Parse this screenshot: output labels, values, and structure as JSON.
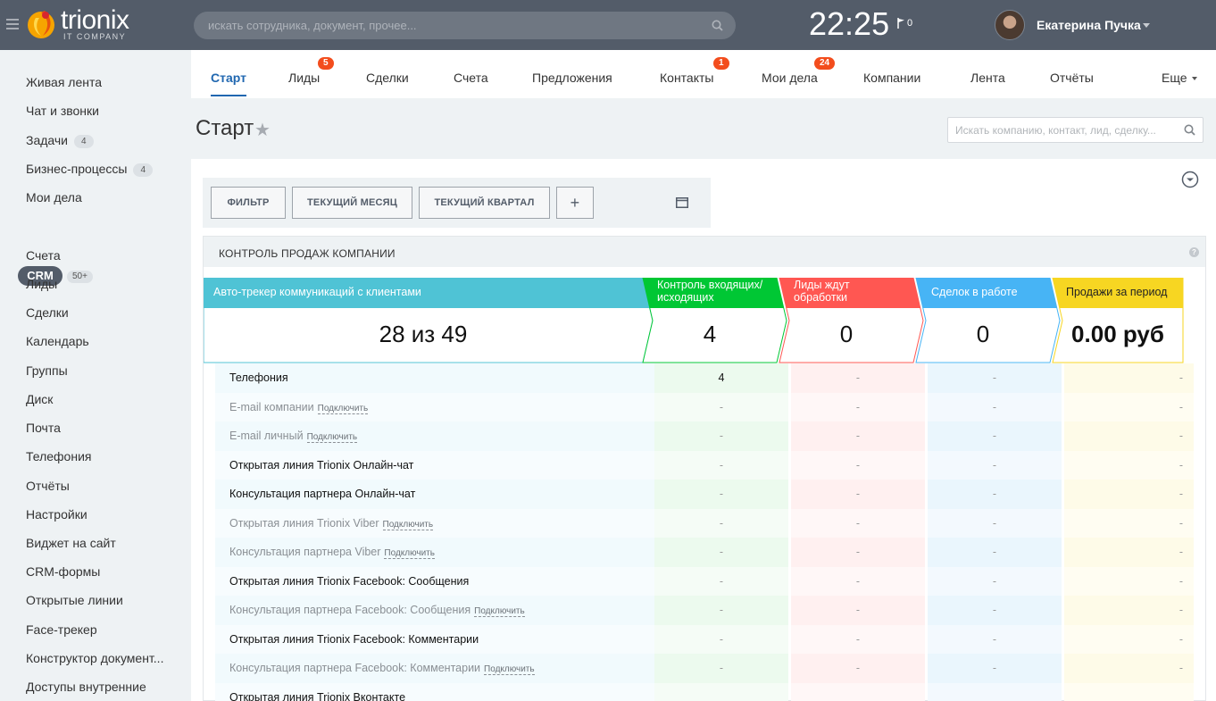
{
  "header": {
    "logo_text": "trionix",
    "logo_sub": "IT COMPANY",
    "search_placeholder": "искать сотрудника, документ, прочее...",
    "clock": "22:25",
    "notifications": "0",
    "user_name": "Екатерина Пучка"
  },
  "sidebar": {
    "items": [
      {
        "label": "Живая лента"
      },
      {
        "label": "Чат и звонки"
      },
      {
        "label": "Задачи",
        "badge": "4"
      },
      {
        "label": "Бизнес-процессы",
        "badge": "4"
      },
      {
        "label": "Мои дела"
      },
      {
        "label": "CRM",
        "badge": "50+"
      },
      {
        "label": "Счета"
      },
      {
        "label": "Лиды"
      },
      {
        "label": "Сделки"
      },
      {
        "label": "Календарь"
      },
      {
        "label": "Группы"
      },
      {
        "label": "Диск"
      },
      {
        "label": "Почта"
      },
      {
        "label": "Телефония"
      },
      {
        "label": "Отчёты"
      },
      {
        "label": "Настройки"
      },
      {
        "label": "Виджет на сайт"
      },
      {
        "label": "CRM-формы"
      },
      {
        "label": "Открытые линии"
      },
      {
        "label": "Face-трекер"
      },
      {
        "label": "Конструктор документ..."
      },
      {
        "label": "Доступы внутренние"
      }
    ]
  },
  "tabs": [
    {
      "label": "Старт"
    },
    {
      "label": "Лиды",
      "badge": "5"
    },
    {
      "label": "Сделки"
    },
    {
      "label": "Счета"
    },
    {
      "label": "Предложения"
    },
    {
      "label": "Контакты",
      "badge": "1"
    },
    {
      "label": "Мои дела",
      "badge": "24"
    },
    {
      "label": "Компании"
    },
    {
      "label": "Лента"
    },
    {
      "label": "Отчёты"
    },
    {
      "label": "Еще"
    }
  ],
  "page": {
    "title": "Старт",
    "search_placeholder": "Искать компанию, контакт, лид, сделку..."
  },
  "filters": {
    "filter": "ФИЛЬТР",
    "month": "ТЕКУЩИЙ МЕСЯЦ",
    "quarter": "ТЕКУЩИЙ КВАРТАЛ",
    "add": "+"
  },
  "panel": {
    "title": "КОНТРОЛЬ ПРОДАЖ КОМПАНИИ",
    "help": "?",
    "funnel": [
      {
        "label": "Авто-трекер коммуникаций с клиентами",
        "value": "28 из 49",
        "color": "#4fc3d5"
      },
      {
        "label": "Контроль входящих/исходящих",
        "value": "4",
        "color": "#00c734"
      },
      {
        "label": "Лиды ждут обработки",
        "value": "0",
        "color": "#ff5752"
      },
      {
        "label": "Сделок в работе",
        "value": "0",
        "color": "#47b4f5"
      },
      {
        "label": "Продажи за период",
        "value": "0.00 руб",
        "color": "#f7d622"
      }
    ],
    "connect_label": "Подключить",
    "rows": [
      {
        "name": "Телефония",
        "active": true,
        "v": [
          "4",
          "-",
          "-",
          "-"
        ]
      },
      {
        "name": "E-mail компании",
        "active": false,
        "v": [
          "-",
          "-",
          "-",
          "-"
        ]
      },
      {
        "name": "E-mail личный",
        "active": false,
        "v": [
          "-",
          "-",
          "-",
          "-"
        ]
      },
      {
        "name": "Открытая линия Trionix Онлайн-чат",
        "active": true,
        "v": [
          "-",
          "-",
          "-",
          "-"
        ]
      },
      {
        "name": "Консультация партнера Онлайн-чат",
        "active": true,
        "v": [
          "-",
          "-",
          "-",
          "-"
        ]
      },
      {
        "name": "Открытая линия Trionix Viber",
        "active": false,
        "v": [
          "-",
          "-",
          "-",
          "-"
        ]
      },
      {
        "name": "Консультация партнера Viber",
        "active": false,
        "v": [
          "-",
          "-",
          "-",
          "-"
        ]
      },
      {
        "name": "Открытая линия Trionix Facebook: Сообщения",
        "active": true,
        "v": [
          "-",
          "-",
          "-",
          "-"
        ]
      },
      {
        "name": "Консультация партнера Facebook: Сообщения",
        "active": false,
        "v": [
          "-",
          "-",
          "-",
          "-"
        ]
      },
      {
        "name": "Открытая линия Trionix Facebook: Комментарии",
        "active": true,
        "v": [
          "-",
          "-",
          "-",
          "-"
        ]
      },
      {
        "name": "Консультация партнера Facebook: Комментарии",
        "active": false,
        "v": [
          "-",
          "-",
          "-",
          "-"
        ]
      },
      {
        "name": "Открытая линия Trionix Вконтакте",
        "active": true,
        "v": [
          "",
          "",
          "",
          ""
        ]
      }
    ]
  }
}
